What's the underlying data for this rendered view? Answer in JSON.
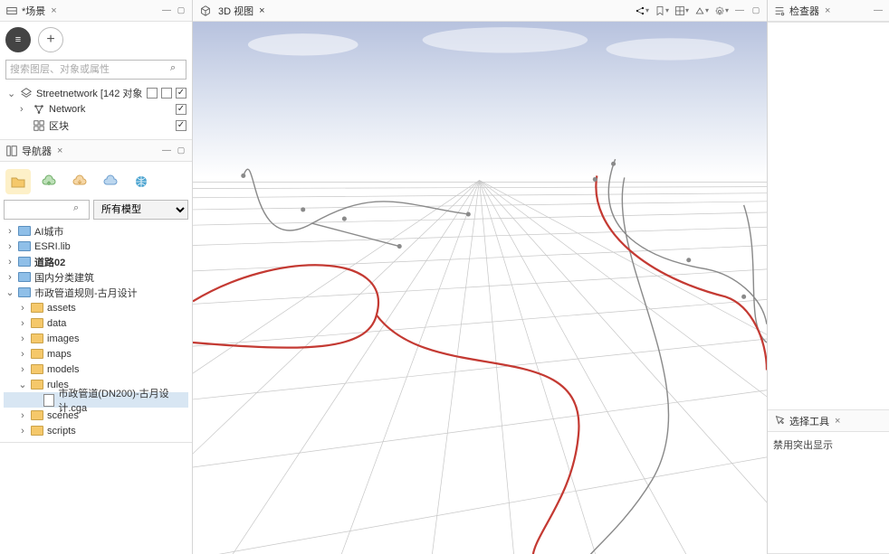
{
  "scene_panel": {
    "title": "*场景",
    "search_placeholder": "搜索图层、对象或属性",
    "tree": {
      "root": {
        "label": "Streetnetwork [142 对象",
        "checked": true
      },
      "child1": {
        "label": "Network",
        "checked": true
      },
      "child2": {
        "label": "区块",
        "checked": true
      }
    }
  },
  "navigator_panel": {
    "title": "导航器",
    "filter_label": "所有模型",
    "tree": [
      {
        "label": "AI城市",
        "depth": 0,
        "twisty": "›",
        "icon": "folder-blue"
      },
      {
        "label": "ESRI.lib",
        "depth": 0,
        "twisty": "›",
        "icon": "folder-blue"
      },
      {
        "label": "道路02",
        "depth": 0,
        "twisty": "›",
        "icon": "folder-blue",
        "bold": true
      },
      {
        "label": "国内分类建筑",
        "depth": 0,
        "twisty": "›",
        "icon": "folder-blue"
      },
      {
        "label": "市政管道规则-古月设计",
        "depth": 0,
        "twisty": "⌄",
        "icon": "folder-blue"
      },
      {
        "label": "assets",
        "depth": 1,
        "twisty": "›",
        "icon": "folder"
      },
      {
        "label": "data",
        "depth": 1,
        "twisty": "›",
        "icon": "folder"
      },
      {
        "label": "images",
        "depth": 1,
        "twisty": "›",
        "icon": "folder"
      },
      {
        "label": "maps",
        "depth": 1,
        "twisty": "›",
        "icon": "folder"
      },
      {
        "label": "models",
        "depth": 1,
        "twisty": "›",
        "icon": "folder"
      },
      {
        "label": "rules",
        "depth": 1,
        "twisty": "⌄",
        "icon": "folder"
      },
      {
        "label": "市政管道(DN200)-古月设计.cga",
        "depth": 2,
        "twisty": "",
        "icon": "file",
        "selected": true
      },
      {
        "label": "scenes",
        "depth": 1,
        "twisty": "›",
        "icon": "folder"
      },
      {
        "label": "scripts",
        "depth": 1,
        "twisty": "›",
        "icon": "folder"
      }
    ]
  },
  "view3d": {
    "title": "3D 视图"
  },
  "inspector": {
    "title": "检查器"
  },
  "selection_tool": {
    "title": "选择工具",
    "body_text": "禁用突出显示"
  },
  "icons": {
    "close": "×",
    "search": "⌕",
    "menu_lines": "≡"
  }
}
